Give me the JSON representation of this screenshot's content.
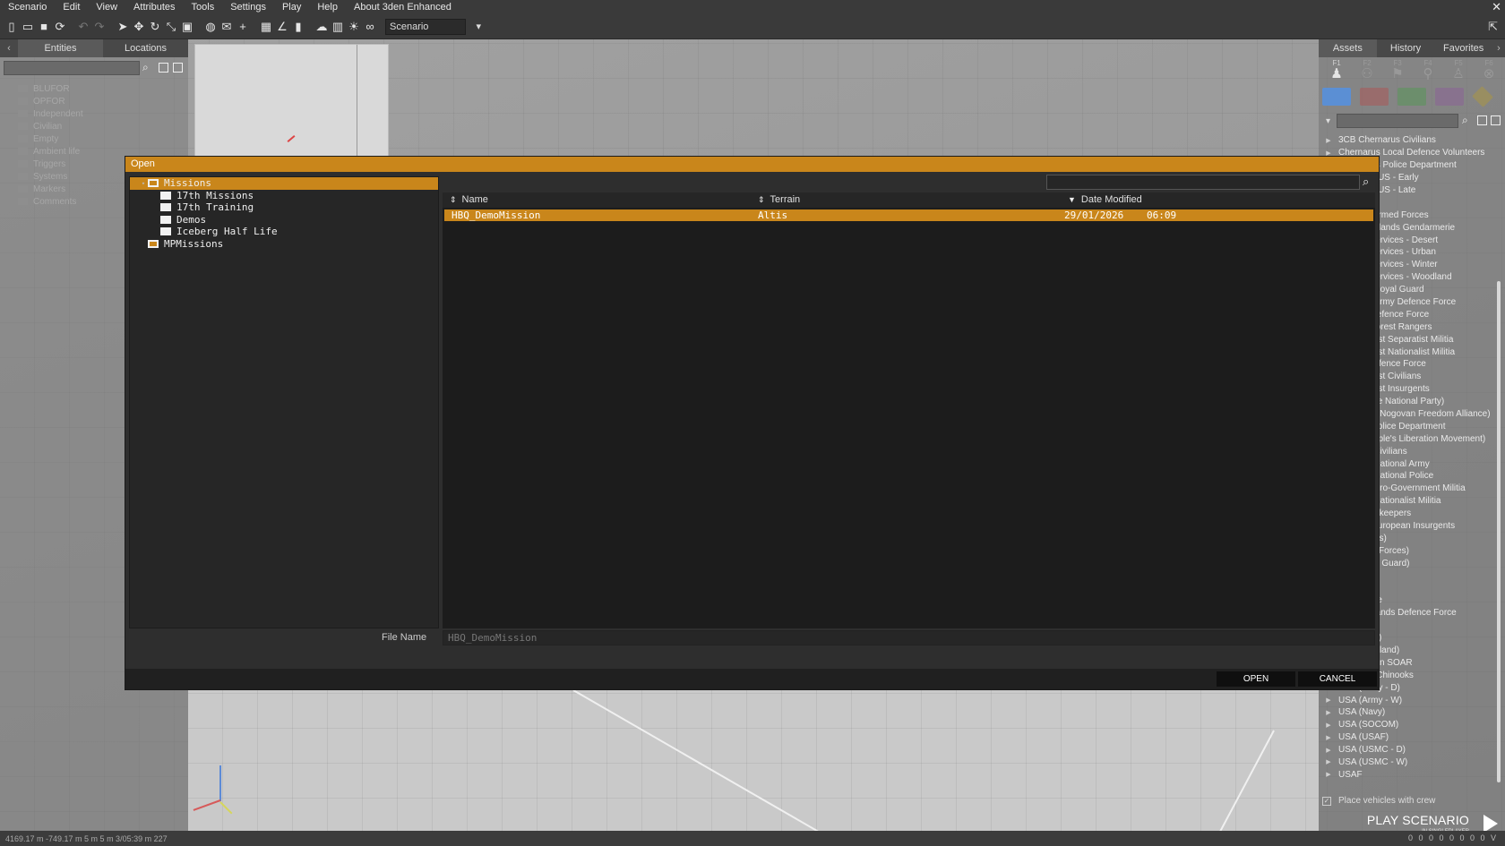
{
  "menubar": {
    "items": [
      "Scenario",
      "Edit",
      "View",
      "Attributes",
      "Tools",
      "Settings",
      "Play",
      "Help",
      "About 3den Enhanced"
    ]
  },
  "toolbar": {
    "mode_select_value": "Scenario"
  },
  "left_panel": {
    "tabs": [
      "Entities",
      "Locations"
    ],
    "tree": [
      "BLUFOR",
      "OPFOR",
      "Independent",
      "Civilian",
      "Empty",
      "Ambient life",
      "Triggers",
      "Systems",
      "Markers",
      "Comments"
    ]
  },
  "right_panel": {
    "tabs": [
      "Assets",
      "History",
      "Favorites"
    ],
    "fkeys": [
      "F1",
      "F2",
      "F3",
      "F4",
      "F5",
      "F6"
    ],
    "side_colors": [
      "#5b8fd4",
      "#c04040",
      "#40a040",
      "#9050a0",
      "#c0a020"
    ],
    "factions": [
      "3CB Chernarus Civilians",
      "Chernarus Local Defence Volunteers",
      "Chernarus Police Department",
      "Cold War US - Early",
      "Cold War US - Late",
      "",
      "Georgia Armed Forces",
      "Horizon Islands Gendarmerie",
      "Karzeg Services - Desert",
      "Karzeg Services - Urban",
      "Karzeg Services - Winter",
      "Karzeg Services - Woodland",
      "Takistan Royal Guard",
      "Livonian Army Defence Force",
      "Malden Defence Force",
      "Malden Forest Rangers",
      "Middle East Separatist Militia",
      "Middle East Nationalist Militia",
      "Middle Defence Force",
      "Middle East Civilians",
      "Middle East Insurgents",
      "NAPA (The National Party)",
      "Nogovan (Nogovan Freedom Alliance)",
      "Nogova Police Department",
      "PLM (People's Liberation Movement)",
      "Takistan Civilians",
      "Takistan National Army",
      "Takistan National Police",
      "Takistan Pro-Government Militia",
      "Takistan Nationalist Militia",
      "UN Peacekeepers",
      "Eastern European Insurgents",
      "UK (Forces)",
      "UK (Land Forces)",
      "UK (Royal Guard)",
      "",
      "",
      "UKSF Elite",
      "United Islands Defence Force",
      "",
      "US (Arctic)",
      "US (Woodland)",
      "US Aviation SOAR",
      "US Army Chinooks",
      "USA (Army - D)",
      "USA (Army - W)",
      "USA (Navy)",
      "USA (SOCOM)",
      "USA (USAF)",
      "USA (USMC - D)",
      "USA (USMC - W)",
      "USAF"
    ],
    "place_vehicles_label": "Place vehicles with crew",
    "play_label": "PLAY SCENARIO",
    "play_sub": "IN SINGLEPLAYER"
  },
  "statusbar": {
    "left": "4169.17 m   -749.17 m   5 m   5 m   3/05:39 m   227",
    "right": "0  0  0  0  0  0  0  0  V"
  },
  "dialog": {
    "title": "Open",
    "tree": [
      {
        "label": "Missions",
        "level": 0,
        "expanded": true,
        "selected": true
      },
      {
        "label": "17th Missions",
        "level": 1,
        "expanded": false,
        "selected": false
      },
      {
        "label": "17th Training",
        "level": 1,
        "expanded": false,
        "selected": false
      },
      {
        "label": "Demos",
        "level": 1,
        "expanded": false,
        "selected": false
      },
      {
        "label": "Iceberg Half Life",
        "level": 1,
        "expanded": false,
        "selected": false
      },
      {
        "label": "MPMissions",
        "level": 0,
        "expanded": false,
        "selected": false
      }
    ],
    "columns": {
      "name": "Name",
      "terrain": "Terrain",
      "date": "Date Modified"
    },
    "rows": [
      {
        "name": "HBQ_DemoMission",
        "terrain": "Altis",
        "date": "29/01/2026",
        "time": "06:09"
      }
    ],
    "file_name_label": "File Name",
    "file_name_value": "HBQ_DemoMission",
    "open_label": "OPEN",
    "cancel_label": "CANCEL"
  }
}
